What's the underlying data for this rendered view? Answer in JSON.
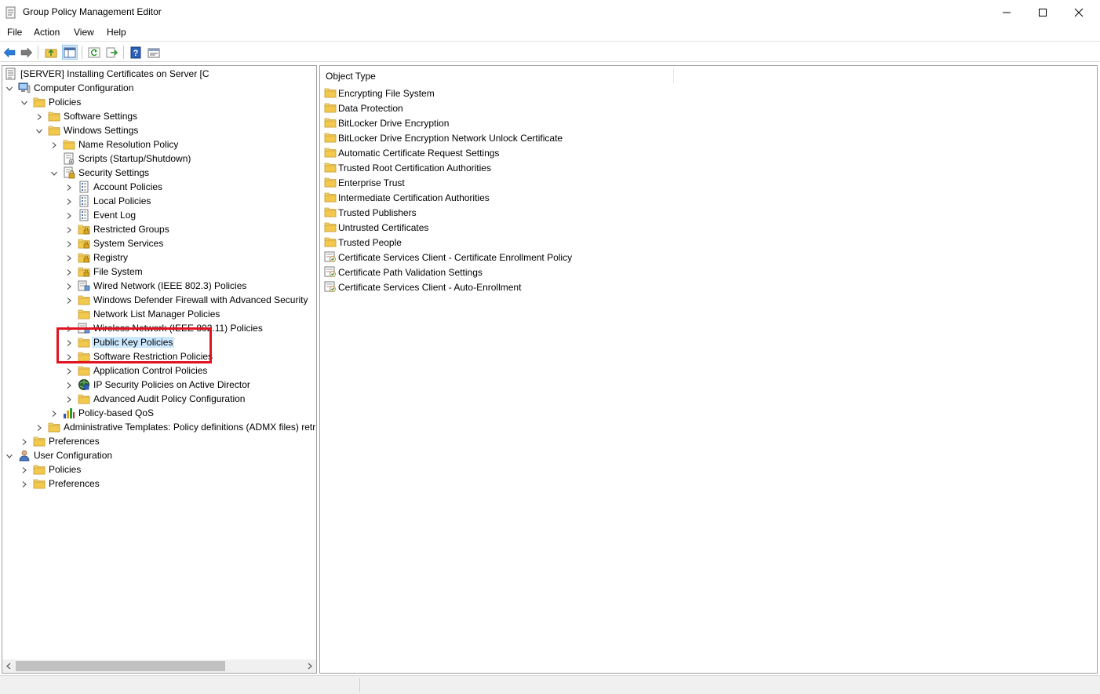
{
  "window": {
    "title": "Group Policy Management Editor",
    "controls": [
      "minimize",
      "maximize",
      "close"
    ]
  },
  "menu": [
    "File",
    "Action",
    "View",
    "Help"
  ],
  "toolbar": {
    "buttons": [
      "back-icon",
      "forward-icon",
      "up-folder-icon",
      "show-hide-tree-icon",
      "refresh-icon",
      "export-list-icon",
      "help-icon",
      "properties-icon"
    ]
  },
  "tree": {
    "items": [
      {
        "label": "[SERVER] Installing Certificates on Server [C",
        "icon": "policy-doc-icon",
        "chevron": "none"
      },
      {
        "label": "Computer Configuration",
        "icon": "computer-icon",
        "chevron": "expanded"
      },
      {
        "label": "Policies",
        "icon": "folder-icon",
        "chevron": "expanded"
      },
      {
        "label": "Software Settings",
        "icon": "folder-icon",
        "chevron": "collapsed"
      },
      {
        "label": "Windows Settings",
        "icon": "folder-icon",
        "chevron": "expanded"
      },
      {
        "label": "Name Resolution Policy",
        "icon": "folder-icon",
        "chevron": "collapsed"
      },
      {
        "label": "Scripts (Startup/Shutdown)",
        "icon": "script-icon",
        "chevron": "none"
      },
      {
        "label": "Security Settings",
        "icon": "security-icon",
        "chevron": "expanded"
      },
      {
        "label": "Account Policies",
        "icon": "policy-list-icon",
        "chevron": "collapsed"
      },
      {
        "label": "Local Policies",
        "icon": "policy-list-icon",
        "chevron": "collapsed"
      },
      {
        "label": "Event Log",
        "icon": "policy-list-icon",
        "chevron": "collapsed"
      },
      {
        "label": "Restricted Groups",
        "icon": "locked-folder-icon",
        "chevron": "collapsed"
      },
      {
        "label": "System Services",
        "icon": "locked-folder-icon",
        "chevron": "collapsed"
      },
      {
        "label": "Registry",
        "icon": "locked-folder-icon",
        "chevron": "collapsed"
      },
      {
        "label": "File System",
        "icon": "locked-folder-icon",
        "chevron": "collapsed"
      },
      {
        "label": "Wired Network (IEEE 802.3) Policies",
        "icon": "network-icon",
        "chevron": "collapsed"
      },
      {
        "label": "Windows Defender Firewall with Advanced Security",
        "icon": "folder-icon",
        "chevron": "collapsed"
      },
      {
        "label": "Network List Manager Policies",
        "icon": "folder-icon",
        "chevron": "none"
      },
      {
        "label": "Wireless Network (IEEE 802.11) Policies",
        "icon": "network-icon",
        "chevron": "collapsed"
      },
      {
        "label": "Public Key Policies",
        "icon": "folder-icon",
        "chevron": "collapsed",
        "selected": true
      },
      {
        "label": "Software Restriction Policies",
        "icon": "folder-icon",
        "chevron": "collapsed"
      },
      {
        "label": "Application Control Policies",
        "icon": "folder-icon",
        "chevron": "collapsed"
      },
      {
        "label": "IP Security Policies on Active Director",
        "icon": "ip-security-icon",
        "chevron": "collapsed"
      },
      {
        "label": "Advanced Audit Policy Configuration",
        "icon": "folder-icon",
        "chevron": "collapsed"
      },
      {
        "label": "Policy-based QoS",
        "icon": "chart-icon",
        "chevron": "collapsed"
      },
      {
        "label": "Administrative Templates: Policy definitions (ADMX files) retr",
        "icon": "folder-icon",
        "chevron": "collapsed"
      },
      {
        "label": "Preferences",
        "icon": "folder-icon",
        "chevron": "collapsed"
      },
      {
        "label": "User Configuration",
        "icon": "user-icon",
        "chevron": "expanded"
      },
      {
        "label": "Policies",
        "icon": "folder-icon",
        "chevron": "collapsed"
      },
      {
        "label": "Preferences",
        "icon": "folder-icon",
        "chevron": "collapsed"
      }
    ]
  },
  "list": {
    "column_header": "Object Type",
    "items": [
      {
        "label": "Encrypting File System",
        "icon": "folder-icon"
      },
      {
        "label": "Data Protection",
        "icon": "folder-icon"
      },
      {
        "label": "BitLocker Drive Encryption",
        "icon": "folder-icon"
      },
      {
        "label": "BitLocker Drive Encryption Network Unlock Certificate",
        "icon": "folder-icon"
      },
      {
        "label": "Automatic Certificate Request Settings",
        "icon": "folder-icon"
      },
      {
        "label": "Trusted Root Certification Authorities",
        "icon": "folder-icon"
      },
      {
        "label": "Enterprise Trust",
        "icon": "folder-icon"
      },
      {
        "label": "Intermediate Certification Authorities",
        "icon": "folder-icon"
      },
      {
        "label": "Trusted Publishers",
        "icon": "folder-icon"
      },
      {
        "label": "Untrusted Certificates",
        "icon": "folder-icon"
      },
      {
        "label": "Trusted People",
        "icon": "folder-icon"
      },
      {
        "label": "Certificate Services Client - Certificate Enrollment Policy",
        "icon": "policy-setting-icon"
      },
      {
        "label": "Certificate Path Validation Settings",
        "icon": "policy-setting-icon"
      },
      {
        "label": "Certificate Services Client - Auto-Enrollment",
        "icon": "policy-setting-icon"
      }
    ]
  },
  "colors": {
    "highlight_box": "#e0141e",
    "selection": "#cce8ff",
    "folder": "#f2c94c"
  }
}
